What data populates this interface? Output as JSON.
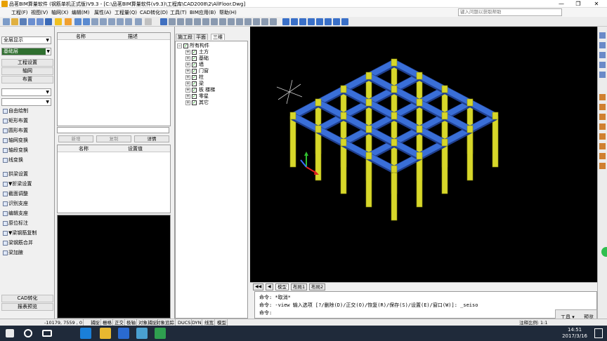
{
  "window": {
    "title": "品茗BIM算量软件 (钢筋单机正式版)V9.3 - [C:\\品茗BIM算量软件(v9.3)\\工程库\\CAD2008\\2\\AllFloor.Dwg]",
    "minimize": "—",
    "restore": "❐",
    "close": "✕"
  },
  "menu": {
    "items": [
      "工程(F)",
      "视图(V)",
      "轴网(X)",
      "编辑(M)",
      "属性(A)",
      "工程量(Q)",
      "CAD转化(D)",
      "工具(T)",
      "BIM应用(B)",
      "帮助(H)"
    ],
    "help_placeholder": "键入问题以获取帮助"
  },
  "left_panel": {
    "display_mode": "全层显示",
    "floor": "基础层",
    "buttons": [
      "工程设置",
      "轴网",
      "布置"
    ],
    "tools": [
      "自由绘制",
      "矩形布置",
      "圆形布置",
      "轴网变换",
      "轴段变换",
      "线变换",
      "拱梁设置",
      "▼折梁设置",
      "截面调整",
      "识别支座",
      "编辑支座",
      "原位标注",
      "▼梁钢筋复制",
      "梁钢筋合并",
      "梁加腋"
    ],
    "bottom_buttons": [
      "CAD转化",
      "报表预览"
    ]
  },
  "props_panel": {
    "col_name": "名称",
    "col_desc": "描述",
    "btn_new": "新增",
    "btn_copy": "复制",
    "btn_detail": "详情",
    "col_name2": "名称",
    "col_setting": "设置值"
  },
  "tree_panel": {
    "tabs": [
      "施工段",
      "平面",
      "三维"
    ],
    "active_tab": "三维",
    "root": "所有构件",
    "items": [
      "土方",
      "基础",
      "墙",
      "门窗",
      "柱",
      "梁",
      "板 楼梯",
      "零星",
      "其它"
    ]
  },
  "cad": {
    "layout_tabs": [
      "模型",
      "布局1",
      "布局2"
    ],
    "active_layout": "模型",
    "beam_color": "#3a6fd8",
    "column_color": "#d7d72a"
  },
  "command": {
    "line1": "命令: *取消*",
    "line2": "命令: -view 输入选项 [?/删除(D)/正交(O)/恢复(R)/保存(S)/设置(E)/窗口(W)]: _seiso",
    "line3": "命令:"
  },
  "status_bar": {
    "coords": "-10179, 7559 , 0",
    "toggles": [
      "捕捉",
      "栅格",
      "正交",
      "极轴",
      "对象捕捉",
      "对象追踪",
      "DUCS",
      "DYN",
      "线宽",
      "模型"
    ],
    "scale_label": "注释比例:",
    "scale_value": "1:1"
  },
  "float_panel": {
    "tools": "工具",
    "preview": "预览"
  },
  "taskbar": {
    "time": "14:51",
    "date": "2017/3/16"
  }
}
